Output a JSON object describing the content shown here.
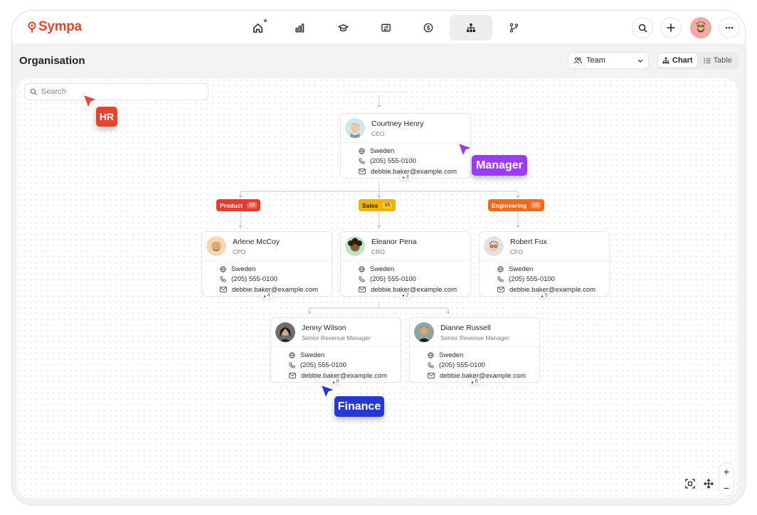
{
  "brand": {
    "name": "Sympa",
    "color": "#e8432e"
  },
  "nav": [
    {
      "icon": "home-icon",
      "active": false,
      "notify": true
    },
    {
      "icon": "bar-chart-icon",
      "active": false
    },
    {
      "icon": "graduation-cap-icon",
      "active": false
    },
    {
      "icon": "transfer-icon",
      "active": false
    },
    {
      "icon": "dollar-circle-icon",
      "active": false
    },
    {
      "icon": "org-chart-icon",
      "active": true
    },
    {
      "icon": "git-branch-icon",
      "active": false
    }
  ],
  "header": {
    "title": "Organisation",
    "team_select": "Team",
    "view_chart": "Chart",
    "view_table": "Table"
  },
  "search": {
    "placeholder": "Search"
  },
  "people": {
    "ceo": {
      "name": "Courtney Henry",
      "role": "CEO",
      "country": "Sweden",
      "phone": "(205) 555-0100",
      "email": "debbie.baker@example.com",
      "reports": "3"
    },
    "cpo": {
      "name": "Arlene McCoy",
      "role": "CPO",
      "country": "Sweden",
      "phone": "(205) 555-0100",
      "email": "debbie.baker@example.com",
      "reports": "4"
    },
    "cro": {
      "name": "Eleanor Pena",
      "role": "CRO",
      "country": "Sweden",
      "phone": "(205) 555-0100",
      "email": "debbie.baker@example.com",
      "reports": "2"
    },
    "cfo": {
      "name": "Robert Fox",
      "role": "CFO",
      "country": "Sweden",
      "phone": "(205) 555-0100",
      "email": "debbie.baker@example.com",
      "reports": "5"
    },
    "jenny": {
      "name": "Jenny Wilson",
      "role": "Senior Revenue Manager",
      "country": "Sweden",
      "phone": "(205) 555-0100",
      "email": "debbie.baker@example.com",
      "reports": "6"
    },
    "dianne": {
      "name": "Dianne Russell",
      "role": "Senior Revenue Manager",
      "country": "Sweden",
      "phone": "(205) 555-0100",
      "email": "debbie.baker@example.com",
      "reports": "6"
    }
  },
  "departments": {
    "product": {
      "label": "Product",
      "count": "15",
      "color": "#e63b2e"
    },
    "sales": {
      "label": "Sales",
      "count": "15",
      "color": "#f0b400"
    },
    "engineering": {
      "label": "Engineering",
      "count": "15",
      "color": "#ef6a1f"
    }
  },
  "cursors": {
    "hr": {
      "label": "HR",
      "color": "#e8432e"
    },
    "manager": {
      "label": "Manager",
      "color": "#9b3cf0"
    },
    "finance": {
      "label": "Finance",
      "color": "#2438d6"
    }
  },
  "zoom": {
    "in": "+",
    "out": "−"
  }
}
